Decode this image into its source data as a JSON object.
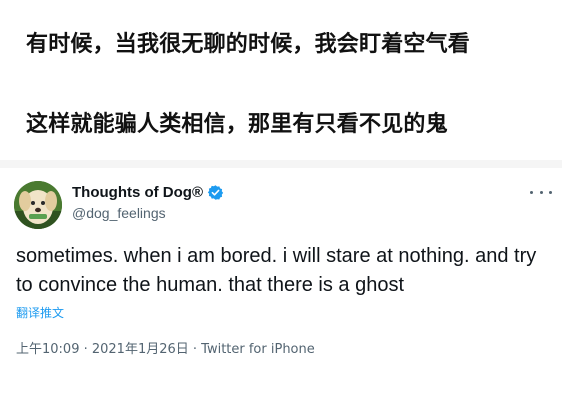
{
  "caption": {
    "line1": "有时候，当我很无聊的时候，我会盯着空气看",
    "line2": "这样就能骗人类相信，那里有只看不见的鬼"
  },
  "tweet": {
    "display_name": "Thoughts of Dog®",
    "handle": "@dog_feelings",
    "verified": true,
    "text": "sometimes. when i am bored. i will stare at nothing. and try to convince the human. that there is a ghost",
    "translate_label": "翻译推文",
    "timestamp": "上午10:09 · 2021年1月26日 · Twitter for iPhone"
  },
  "icons": {
    "verified": "verified-badge-icon",
    "more": "more-options-icon",
    "avatar": "dog-avatar"
  },
  "colors": {
    "accent": "#1d9bf0",
    "text_primary": "#0f1419",
    "text_secondary": "#536471"
  }
}
